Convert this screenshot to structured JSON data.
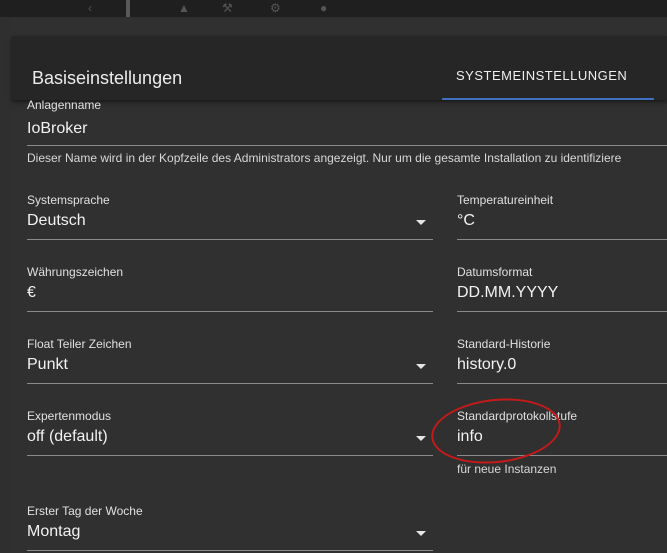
{
  "dialog": {
    "title": "Basiseinstellungen",
    "tab_label": "SYSTEMEINSTELLUNGEN"
  },
  "fields": {
    "anlagenname": {
      "label": "Anlagenname",
      "value": "IoBroker",
      "helper": "Dieser Name wird in der Kopfzeile des Administrators angezeigt. Nur um die gesamte Installation zu identifiziere"
    },
    "systemsprache": {
      "label": "Systemsprache",
      "value": "Deutsch"
    },
    "temperatureinheit": {
      "label": "Temperatureinheit",
      "value": "°C"
    },
    "waehrungszeichen": {
      "label": "Währungszeichen",
      "value": "€"
    },
    "datumsformat": {
      "label": "Datumsformat",
      "value": "DD.MM.YYYY"
    },
    "float_teiler": {
      "label": "Float Teiler Zeichen",
      "value": "Punkt"
    },
    "standard_historie": {
      "label": "Standard-Historie",
      "value": "history.0"
    },
    "expertenmodus": {
      "label": "Expertenmodus",
      "value": "off (default)"
    },
    "standardprotokollstufe": {
      "label": "Standardprotokollstufe",
      "value": "info",
      "helper": "für neue Instanzen"
    },
    "erster_tag": {
      "label": "Erster Tag der Woche",
      "value": "Montag"
    }
  },
  "colors": {
    "accent": "#3f6fbf",
    "annotation": "#c41a1a"
  },
  "icons": [
    "chevron-left-icon",
    "home-icon",
    "wrench-icon",
    "gear-icon",
    "plugin-icon"
  ]
}
